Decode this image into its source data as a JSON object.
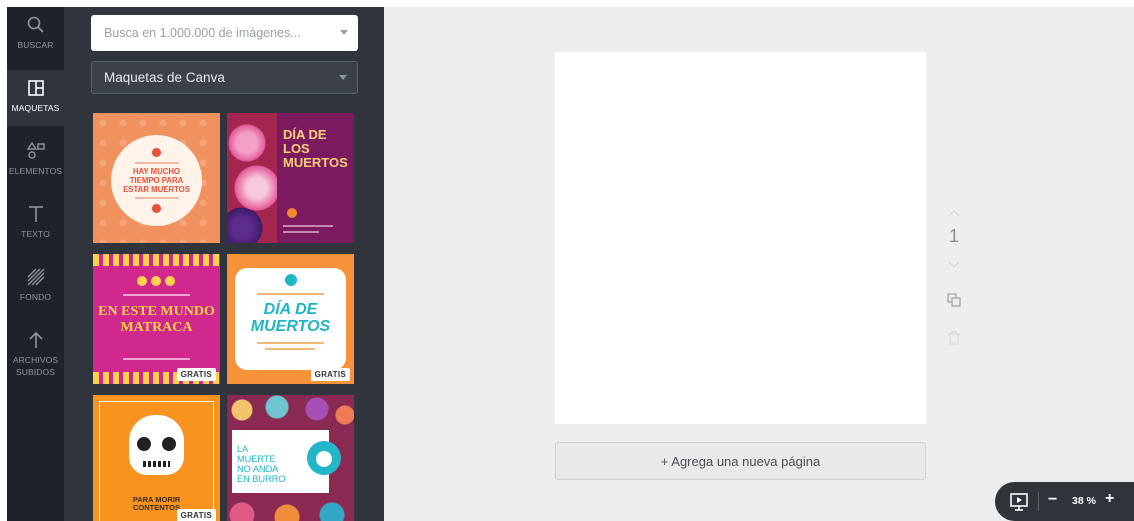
{
  "rail": {
    "items": [
      {
        "label": "BUSCAR"
      },
      {
        "label": "MAQUETAS"
      },
      {
        "label": "ELEMENTOS"
      },
      {
        "label": "TEXTO"
      },
      {
        "label": "FONDO"
      },
      {
        "label": "ARCHIVOS SUBIDOS"
      }
    ]
  },
  "panel": {
    "search_placeholder": "Busca en 1.000.000 de imágenes...",
    "select_value": "Maquetas de Canva",
    "badge": "GRATIS"
  },
  "templates": {
    "t1_title": "HAY MUCHO TIEMPO PARA ESTAR MUERTOS",
    "t2_title": "DÍA DE LOS MUERTOS",
    "t3_title": "EN ESTE MUNDO MATRACA",
    "t4_title": "DÍA DE MUERTOS",
    "t5_title": "PARA MORIR CONTENTOS",
    "t6_title": "LA MUERTE NO ANDA EN BURRO"
  },
  "editor": {
    "add_page": "+ Agrega una nueva página",
    "page_number": "1",
    "zoom": "38 %",
    "zoom_minus": "−",
    "zoom_plus": "+"
  },
  "colors": {
    "rail_bg": "#1f2329",
    "panel_bg": "#30353d",
    "workspace_bg": "#eceef0"
  }
}
